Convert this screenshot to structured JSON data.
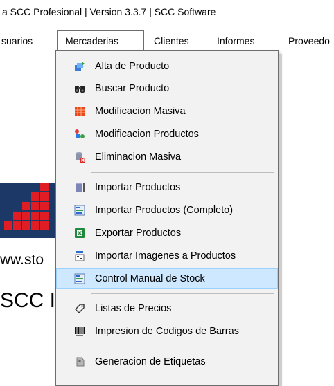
{
  "window": {
    "title": "a SCC Profesional | Version 3.3.7 | SCC Software"
  },
  "menubar": {
    "items": [
      {
        "label": "suarios"
      },
      {
        "label": "Mercaderias",
        "active": true
      },
      {
        "label": "Clientes"
      },
      {
        "label": "Informes"
      },
      {
        "label": "Proveedo"
      }
    ]
  },
  "background": {
    "url_text": "ww.sto",
    "name_text": "SCC I"
  },
  "dropdown": {
    "items": [
      {
        "label": "Alta de Producto",
        "icon": "add-product-icon"
      },
      {
        "label": "Buscar Producto",
        "icon": "binoculars-icon"
      },
      {
        "label": "Modificacion Masiva",
        "icon": "grid-icon"
      },
      {
        "label": "Modificacion Productos",
        "icon": "edit-products-icon"
      },
      {
        "label": "Eliminacion Masiva",
        "icon": "delete-icon"
      },
      {
        "label": "Importar Productos",
        "icon": "import-icon"
      },
      {
        "label": "Importar Productos (Completo)",
        "icon": "import-full-icon"
      },
      {
        "label": "Exportar Productos",
        "icon": "excel-icon"
      },
      {
        "label": "Importar Imagenes a Productos",
        "icon": "image-import-icon"
      },
      {
        "label": "Control Manual de Stock",
        "icon": "stock-icon",
        "highlighted": true
      },
      {
        "label": "Listas de Precios",
        "icon": "tag-icon"
      },
      {
        "label": "Impresion de Codigos de Barras",
        "icon": "barcode-icon"
      },
      {
        "label": "Generacion de Etiquetas",
        "icon": "label-icon"
      }
    ]
  },
  "colors": {
    "highlight": "#cde8ff",
    "highlight_border": "#99d1ff",
    "menu_bg": "#f2f2f2",
    "logo_blue": "#1c3867",
    "logo_red": "#e01d25"
  }
}
